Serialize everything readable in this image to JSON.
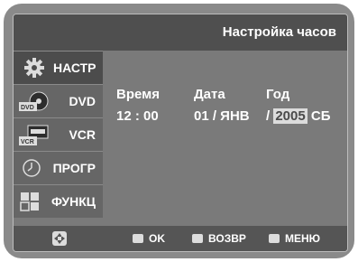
{
  "title": "Настройка часов",
  "sidebar": {
    "items": [
      {
        "label": "НАСТР",
        "icon": "gear-icon",
        "active": true
      },
      {
        "label": "DVD",
        "icon": "dvd-icon",
        "icon_text": "DVD",
        "active": false
      },
      {
        "label": "VCR",
        "icon": "vcr-icon",
        "icon_text": "VCR",
        "active": false
      },
      {
        "label": "ПРОГР",
        "icon": "clock-icon",
        "active": false
      },
      {
        "label": "ФУНКЦ",
        "icon": "function-icon",
        "active": false
      }
    ]
  },
  "fields": {
    "time": {
      "label": "Время",
      "value": "12 : 00"
    },
    "date": {
      "label": "Дата",
      "value": "01 / ЯНВ"
    },
    "year": {
      "label": "Год",
      "prefix": "/",
      "value": "2005",
      "day": "СБ"
    }
  },
  "bottom": {
    "ok": "OK",
    "back": "ВОЗВР",
    "menu": "МЕНЮ"
  },
  "colors": {
    "title_bg": "#4f4f4f",
    "screen_bg": "#7a7a7a",
    "highlight": "#dcdcdc"
  }
}
